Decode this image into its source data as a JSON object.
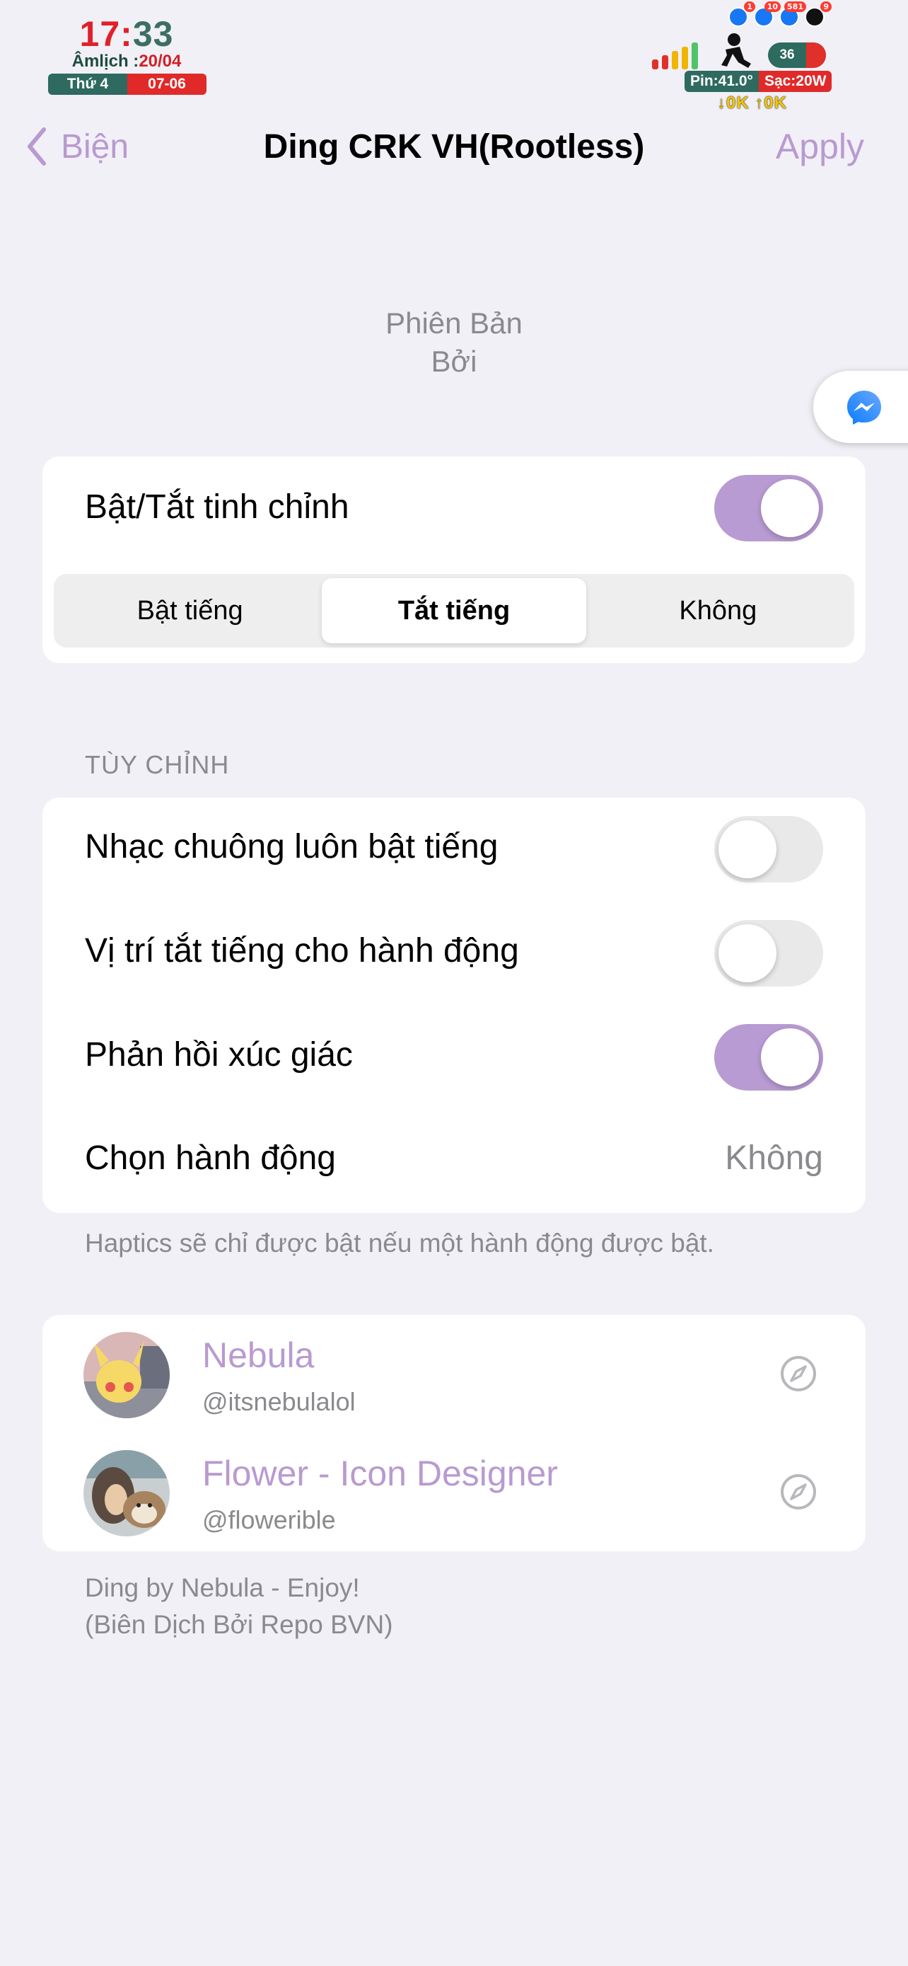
{
  "status_bar": {
    "clock": {
      "hour": "17",
      "colon": ":",
      "minute": "33"
    },
    "lunar_label": "Âmlịch :",
    "lunar_date": "20/04",
    "weekday": "Thứ 4",
    "date": "07-06",
    "notification_badges": [
      "1",
      "10",
      "581",
      "9"
    ],
    "battery_percent": "36",
    "battery_level": 0.66,
    "pin_temp": "Pin:41.0°",
    "charge": "Sạc:20W",
    "net_speed": "↓0K ↑0K",
    "colors": {
      "green": "#2e6a60",
      "red": "#e02a2a",
      "yellow": "#f3c400"
    }
  },
  "nav": {
    "back_label": "Biện",
    "title": "Ding CRK VH(Rootless)",
    "apply_label": "Apply",
    "accent": "#b99ad0"
  },
  "header": {
    "line1": "Phiên Bản",
    "line2": "Bởi"
  },
  "main_card": {
    "toggle_label": "Bật/Tắt tinh chỉnh",
    "toggle_on": true,
    "segments": [
      "Bật tiếng",
      "Tắt tiếng",
      "Không"
    ],
    "selected_segment": "Tắt tiếng"
  },
  "custom_section": {
    "title": "TÙY CHỈNH",
    "rows": [
      {
        "label": "Nhạc chuông luôn bật tiếng",
        "on": false
      },
      {
        "label": "Vị trí tắt tiếng cho hành động",
        "on": false
      },
      {
        "label": "Phản hồi xúc giác",
        "on": true
      }
    ],
    "action_label": "Chọn hành động",
    "action_value": "Không",
    "footer": "Haptics sẽ chỉ được bật nếu một hành động được bật."
  },
  "credits": [
    {
      "name": "Nebula",
      "handle": "@itsnebulalol"
    },
    {
      "name": "Flower - Icon Designer",
      "handle": "@floweribl​e"
    }
  ],
  "footer": {
    "line1": "Ding by Nebula - Enjoy!",
    "line2": "(Biên Dịch Bởi Repo BVN)"
  }
}
